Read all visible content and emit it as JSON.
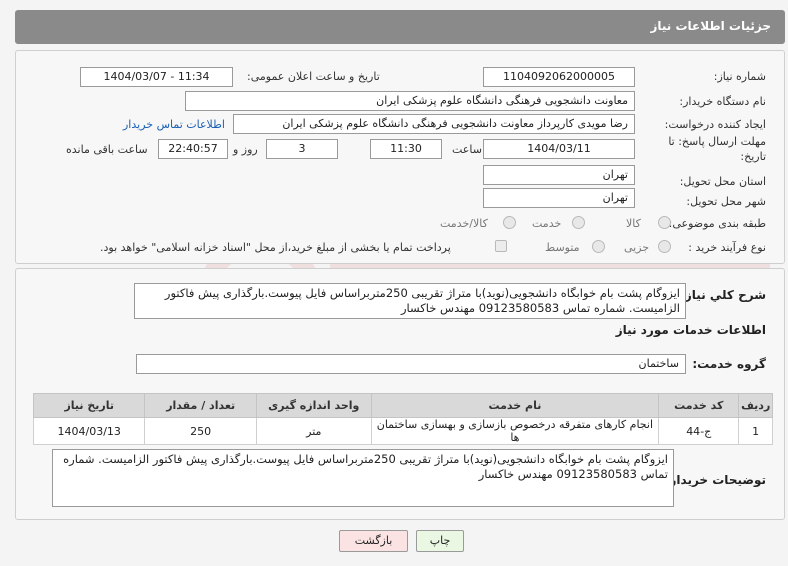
{
  "header": {
    "title": "جزئیات اطلاعات نیاز"
  },
  "form": {
    "need_number_label": "شماره نیاز:",
    "need_number": "1104092062000005",
    "announce_label": "تاریخ و ساعت اعلان عمومی:",
    "announce_value": "1404/03/07 - 11:34",
    "buyer_org_label": "نام دستگاه خریدار:",
    "buyer_org": "معاونت دانشجویی  فرهنگی دانشگاه علوم پزشکی ایران",
    "creator_label": "ایجاد کننده درخواست:",
    "creator": "رضا  مویدی  کارپرداز معاونت دانشجویی  فرهنگی دانشگاه علوم پزشکی ایران",
    "contact_link": "اطلاعات تماس خریدار",
    "deadline_label_1": "مهلت ارسال پاسخ: تا",
    "deadline_label_2": "تاریخ:",
    "deadline_date": "1404/03/11",
    "time_label": "ساعت",
    "deadline_time": "11:30",
    "days_value": "3",
    "days_label": "روز و",
    "remaining_time": "22:40:57",
    "remaining_label": "ساعت باقی مانده",
    "province_label": "استان محل تحویل:",
    "province": "تهران",
    "city_label": "شهر محل تحویل:",
    "city": "تهران",
    "category_label": "طبقه بندی موضوعی:",
    "category_options": [
      "کالا",
      "خدمت",
      "کالا/خدمت"
    ],
    "process_label": "نوع فرآیند خرید :",
    "process_options": [
      "جزیی",
      "متوسط"
    ],
    "treasury_note": "پرداخت تمام یا بخشی از مبلغ خرید،از محل \"اسناد خزانه اسلامی\" خواهد بود."
  },
  "description": {
    "label": "شرح کلي نياز:",
    "text": "ایزوگام پشت بام خوابگاه دانشجویی(نوید)با متراژ تقریبی 250متربراساس فایل پیوست.بارگذاری پیش فاکتور الزامیست. شماره تماس 09123580583 مهندس خاکسار"
  },
  "services": {
    "section_title": "اطلاعات خدمات مورد نياز",
    "group_label": "گروه خدمت:",
    "group_value": "ساختمان",
    "columns": [
      "ردیف",
      "کد خدمت",
      "نام خدمت",
      "واحد اندازه گیری",
      "تعداد / مقدار",
      "تاریخ نیاز"
    ],
    "rows": [
      {
        "index": "1",
        "code": "ج-44",
        "name": "انجام کارهای متفرقه درخصوص بازسازی و بهسازی ساختمان ها",
        "unit": "متر",
        "qty": "250",
        "date": "1404/03/13"
      }
    ]
  },
  "buyer_notes": {
    "label": "توضیحات خریدار:",
    "text": "ایزوگام پشت بام خوابگاه دانشجویی(نوید)با متراژ تقریبی 250متربراساس فایل پیوست.بارگذاری پیش فاکتور الزامیست. شماره تماس 09123580583 مهندس خاکسار"
  },
  "buttons": {
    "print": "چاپ",
    "back": "بازگشت"
  },
  "colors": {
    "header_bg": "#8a8a8a",
    "link": "#1a5fb4",
    "print_bg": "#eaf7e2",
    "back_bg": "#fbe3e3"
  }
}
